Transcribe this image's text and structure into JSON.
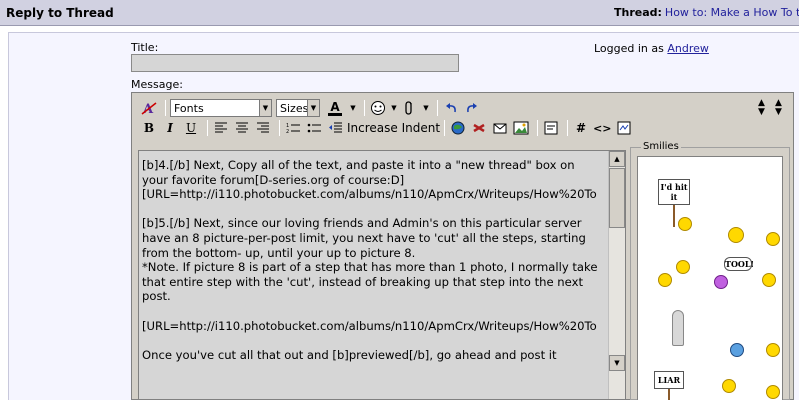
{
  "header": {
    "title": "Reply to Thread",
    "thread_label": "Thread:",
    "thread_link": "How to: Make a How To th"
  },
  "form": {
    "title_label": "Title:",
    "message_label": "Message:",
    "logged_in_label": "Logged in as",
    "username": "Andrew",
    "title_value": ""
  },
  "toolbar": {
    "font_select": "Fonts",
    "size_select": "Sizes",
    "increase_indent": "Increase Indent",
    "bold": "B",
    "italic": "I",
    "underline": "U",
    "text_color_letter": "A"
  },
  "message_text": "[b]4.[/b] Next, Copy all of the text, and paste it into a \"new thread\" box on your favorite forum[D-series.org of course:D]\n[URL=http://i110.photobucket.com/albums/n110/ApmCrx/Writeups/How%20To\n\n[b]5.[/b] Next, since our loving friends and Admin's on this particular server have an 8 picture-per-post limit, you next have to 'cut' all the steps, starting from the bottom- up, until your up to picture 8.\n*Note. If picture 8 is part of a step that has more than 1 photo, I normally take that entire step with the 'cut', instead of breaking up that step into the next post.\n\n[URL=http://i110.photobucket.com/albums/n110/ApmCrx/Writeups/How%20To\n\nOnce you've cut all that out and [b]previewed[/b], go ahead and post it",
  "smilies": {
    "legend": "Smilies",
    "sign1": "I'd hit it",
    "sign2": "TOOL!",
    "sign3": "LIAR"
  },
  "colors": {
    "header_bg": "#d1d1e1",
    "panel_bg": "#f5f5ff",
    "editor_bg": "#d4d0c8",
    "textarea_bg": "#d6d6d6",
    "link": "#22229c"
  }
}
